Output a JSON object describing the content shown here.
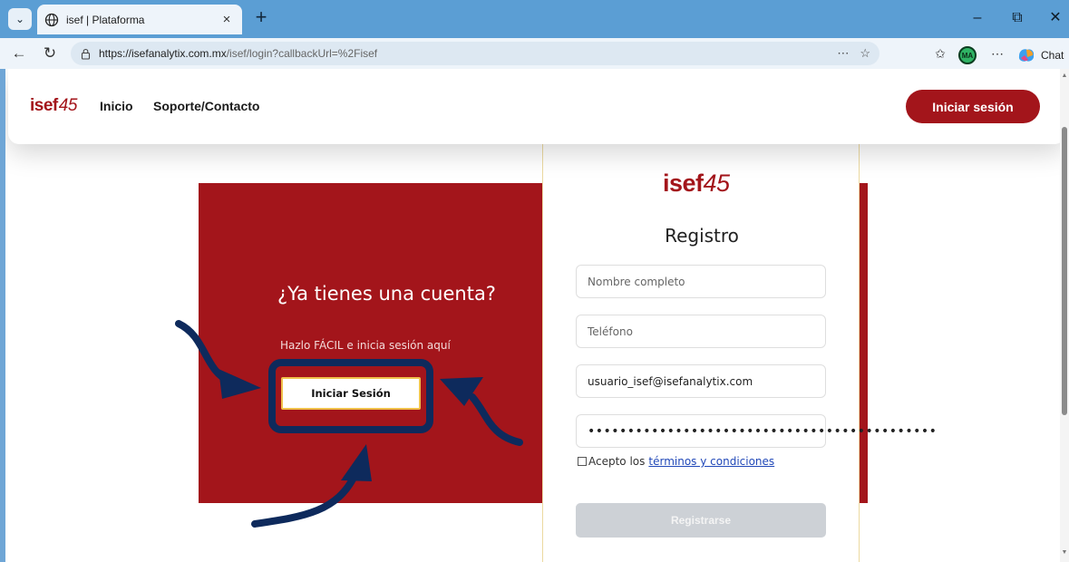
{
  "browser": {
    "tab_title": "isef | Plataforma",
    "tab_close": "×",
    "new_tab": "+",
    "url_host": "https://isefanalytix.com.mx",
    "url_path": "/isef/login?callbackUrl=%2Fisef",
    "profile_initials": "MA",
    "chat_label": "Chat",
    "icons": [
      "tab-list-chevron-icon",
      "globe-icon",
      "back-arrow-icon",
      "refresh-icon",
      "lock-icon",
      "favorites-star-icon",
      "collections-icon",
      "more-icon",
      "copilot-icon",
      "minimize-icon",
      "restore-icon",
      "close-icon"
    ]
  },
  "header": {
    "brand": "isef",
    "brand_number": "45",
    "nav": [
      "Inicio",
      "Soporte/Contacto"
    ],
    "login_button": "Iniciar sesión"
  },
  "panel": {
    "title": "¿Ya tienes una cuenta?",
    "subtitle": "Hazlo FÁCIL e inicia sesión aquí",
    "login_button": "Iniciar Sesión"
  },
  "register": {
    "logo": "isef",
    "logo_number": "45",
    "title": "Registro",
    "name_placeholder": "Nombre completo",
    "phone_placeholder": "Teléfono",
    "email_value": "usuario_isef@isefanalytix.com",
    "password_value": "••••••••••••••••••••••••••••••••••••••••••••",
    "terms_text": "Acepto los",
    "terms_link": "términos y condiciones",
    "submit_button": "Registrarse"
  },
  "colors": {
    "brand_red": "#a3151b",
    "annotation_navy": "#0e2a5c",
    "browser_blue": "#5b9ed4"
  }
}
